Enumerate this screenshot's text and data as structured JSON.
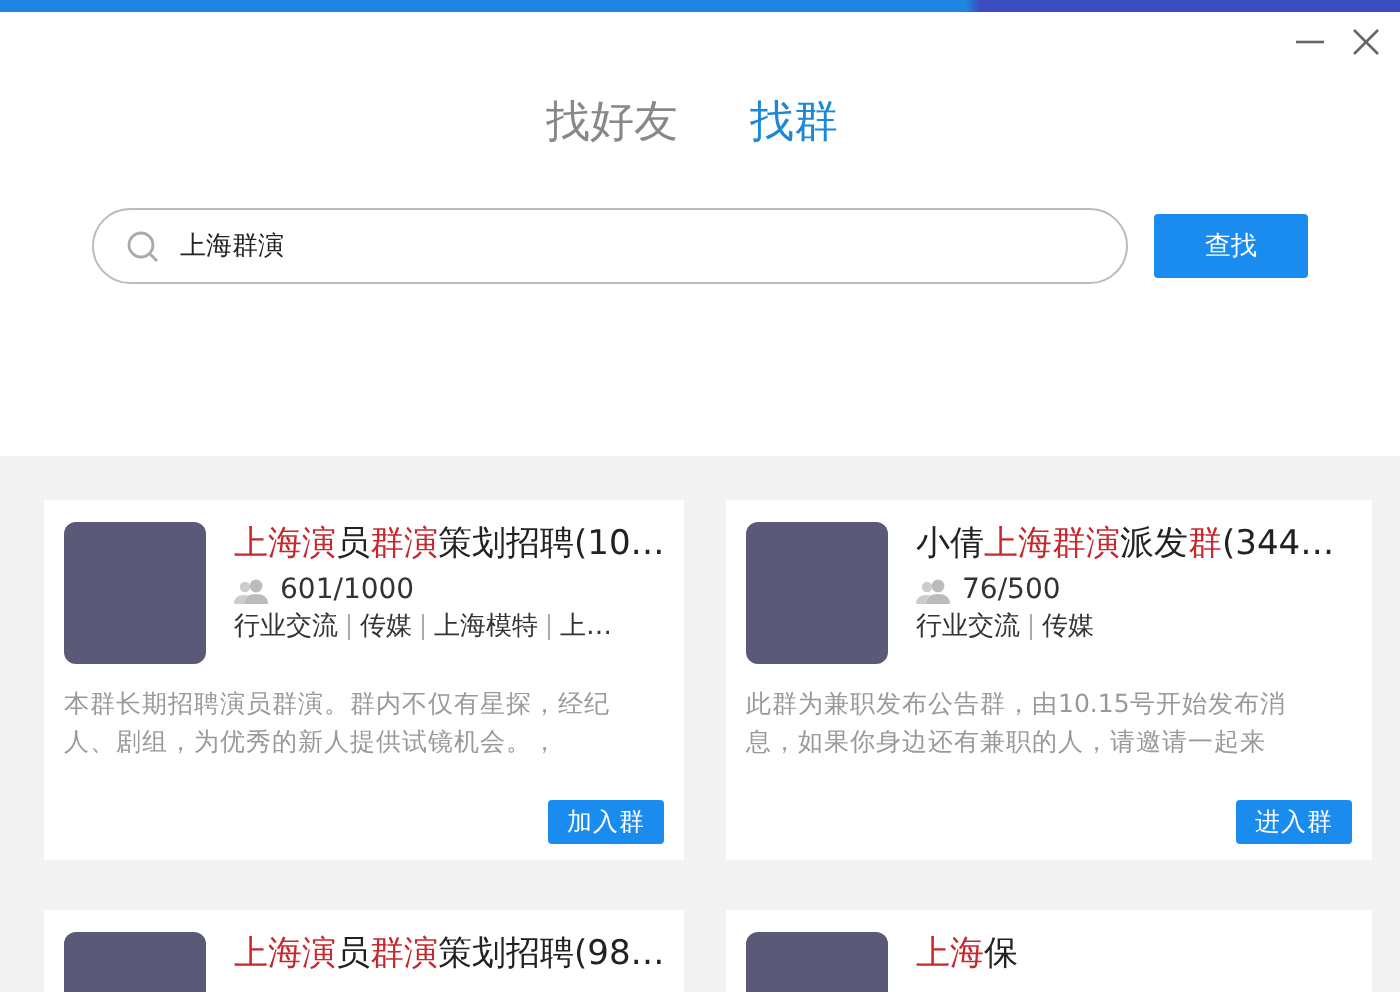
{
  "tabs": [
    {
      "label": "找好友",
      "selected": false
    },
    {
      "label": "找群",
      "selected": true
    }
  ],
  "search": {
    "value": "上海群演",
    "button": "查找"
  },
  "groups": [
    {
      "title": [
        {
          "text": "上海演",
          "highlight": true
        },
        {
          "text": "员",
          "highlight": false
        },
        {
          "text": "群演",
          "highlight": true
        },
        {
          "text": "策划招聘(10…",
          "highlight": false
        }
      ],
      "members": "601/1000",
      "tags": [
        "行业交流",
        "传媒",
        "上海模特",
        "上…"
      ],
      "description": "本群长期招聘演员群演。群内不仅有星探，经纪人、剧组，为优秀的新人提供试镜机会。，",
      "button": "加入群"
    },
    {
      "title": [
        {
          "text": "小倩",
          "highlight": false
        },
        {
          "text": "上海群演",
          "highlight": true
        },
        {
          "text": "派发",
          "highlight": false
        },
        {
          "text": "群",
          "highlight": true
        },
        {
          "text": "(344…",
          "highlight": false
        }
      ],
      "members": "76/500",
      "tags": [
        "行业交流",
        "传媒"
      ],
      "description": "此群为兼职发布公告群，由10.15号开始发布消息，如果你身边还有兼职的人，请邀请一起来",
      "button": "进入群"
    },
    {
      "title": [
        {
          "text": "上海演",
          "highlight": true
        },
        {
          "text": "员",
          "highlight": false
        },
        {
          "text": "群演",
          "highlight": true
        },
        {
          "text": "策划招聘(98…",
          "highlight": false
        }
      ]
    },
    {
      "title": [
        {
          "text": "上海",
          "highlight": true
        },
        {
          "text": "保",
          "highlight": false
        }
      ]
    }
  ]
}
